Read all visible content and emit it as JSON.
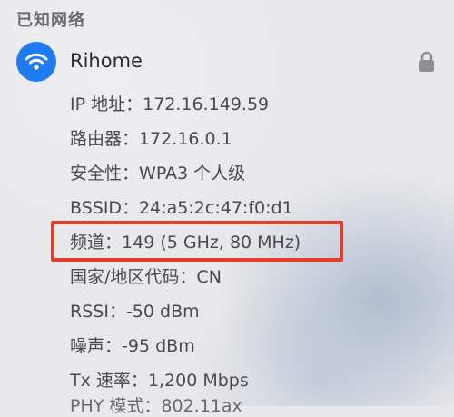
{
  "section": {
    "title": "已知网络"
  },
  "network": {
    "name": "Rihome",
    "icon": "wifi-icon",
    "lock_icon": "lock-icon",
    "accent_color": "#1f7cf0"
  },
  "details": [
    {
      "label": "IP 地址",
      "value": "172.16.149.59"
    },
    {
      "label": "路由器",
      "value": "172.16.0.1"
    },
    {
      "label": "安全性",
      "value": "WPA3 个人级"
    },
    {
      "label": "BSSID",
      "value": "24:a5:2c:47:f0:d1"
    },
    {
      "label": "频道",
      "value": "149 (5 GHz, 80 MHz)"
    },
    {
      "label": "国家/地区代码",
      "value": "CN"
    },
    {
      "label": "RSSI",
      "value": "-50 dBm"
    },
    {
      "label": "噪声",
      "value": "-95 dBm"
    },
    {
      "label": "Tx 速率",
      "value": "1,200 Mbps"
    }
  ],
  "partial_row": {
    "label": "PHY 模式",
    "value": "802.11ax"
  },
  "highlight": {
    "color": "#e53d2b",
    "target": "频道"
  }
}
